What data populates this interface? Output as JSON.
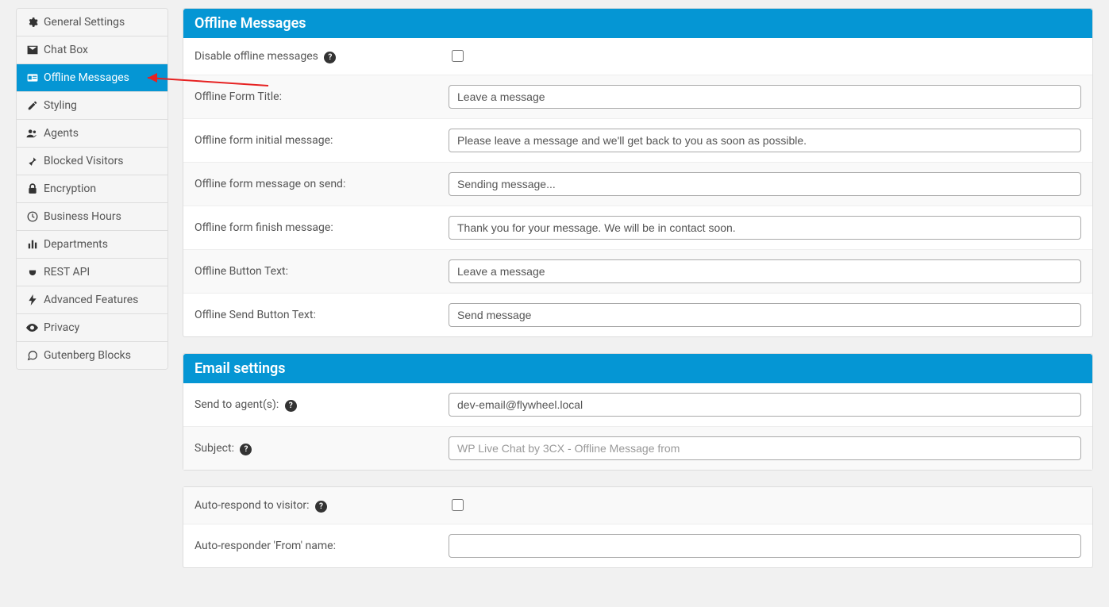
{
  "sidebar": {
    "items": [
      {
        "label": "General Settings",
        "icon": "gear-icon"
      },
      {
        "label": "Chat Box",
        "icon": "envelope-icon"
      },
      {
        "label": "Offline Messages",
        "icon": "id-card-icon",
        "active": true
      },
      {
        "label": "Styling",
        "icon": "pencil-icon"
      },
      {
        "label": "Agents",
        "icon": "users-icon"
      },
      {
        "label": "Blocked Visitors",
        "icon": "pin-icon"
      },
      {
        "label": "Encryption",
        "icon": "lock-icon"
      },
      {
        "label": "Business Hours",
        "icon": "clock-icon"
      },
      {
        "label": "Departments",
        "icon": "columns-icon"
      },
      {
        "label": "REST API",
        "icon": "plug-icon"
      },
      {
        "label": "Advanced Features",
        "icon": "bolt-icon"
      },
      {
        "label": "Privacy",
        "icon": "eye-icon"
      },
      {
        "label": "Gutenberg Blocks",
        "icon": "comments-icon"
      }
    ]
  },
  "panels": {
    "offline": {
      "title": "Offline Messages",
      "disable_label": "Disable offline messages",
      "disable_checked": false,
      "form_title_label": "Offline Form Title:",
      "form_title_value": "Leave a message",
      "initial_msg_label": "Offline form initial message:",
      "initial_msg_value": "Please leave a message and we'll get back to you as soon as possible.",
      "on_send_label": "Offline form message on send:",
      "on_send_value": "Sending message...",
      "finish_label": "Offline form finish message:",
      "finish_value": "Thank you for your message. We will be in contact soon.",
      "button_text_label": "Offline Button Text:",
      "button_text_value": "Leave a message",
      "send_button_text_label": "Offline Send Button Text:",
      "send_button_text_value": "Send message"
    },
    "email": {
      "title": "Email settings",
      "send_to_label": "Send to agent(s):",
      "send_to_value": "dev-email@flywheel.local",
      "subject_label": "Subject:",
      "subject_placeholder": "WP Live Chat by 3CX - Offline Message from",
      "subject_value": "",
      "auto_respond_label": "Auto-respond to visitor:",
      "auto_respond_checked": false,
      "from_name_label": "Auto-responder 'From' name:",
      "from_name_value": ""
    }
  }
}
